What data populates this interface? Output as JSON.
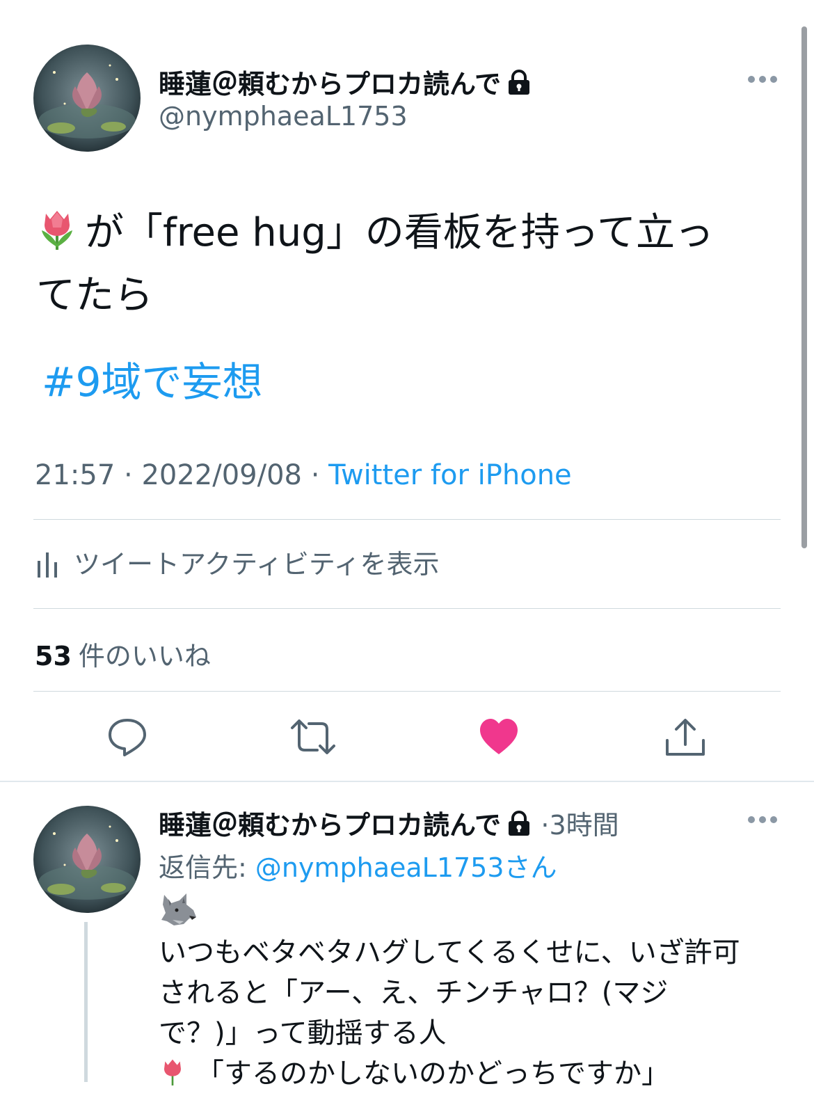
{
  "main_tweet": {
    "display_name": "睡蓮＠頼むからプロカ読んで",
    "handle": "@nymphaeaL1753",
    "text_line1": "が「free hug」の看板を持って立っ",
    "text_line2": "てたら",
    "hashtag": "#9域で妄想",
    "time": "21:57",
    "date": "2022/09/08",
    "separator": "·",
    "source": "Twitter for iPhone",
    "activity_label": "ツイートアクティビティを表示",
    "likes_count": "53",
    "likes_label": "件のいいね",
    "liked": true
  },
  "actions": {
    "reply_icon": "speech-bubble-icon",
    "retweet_icon": "retweet-icon",
    "like_icon": "heart-icon",
    "share_icon": "share-icon"
  },
  "reply_tweet": {
    "display_name": "睡蓮＠頼むからプロカ読んで",
    "separator": "·",
    "time_ago": "3時間",
    "reply_prefix": "返信先:",
    "reply_mention": "@nymphaeaL1753",
    "reply_suffix": "さん",
    "body_line1": "いつもベタベタハグしてくるくせに、いざ許可",
    "body_line2": "されると「アー、え、チンチャロ？(マジ",
    "body_line3": "で？)」って動揺する人",
    "body_line4": "「するのかしないのかどっちですか」"
  },
  "colors": {
    "accent": "#1d9bf0",
    "like": "#f91880",
    "text": "#0f1419",
    "muted": "#536471"
  }
}
